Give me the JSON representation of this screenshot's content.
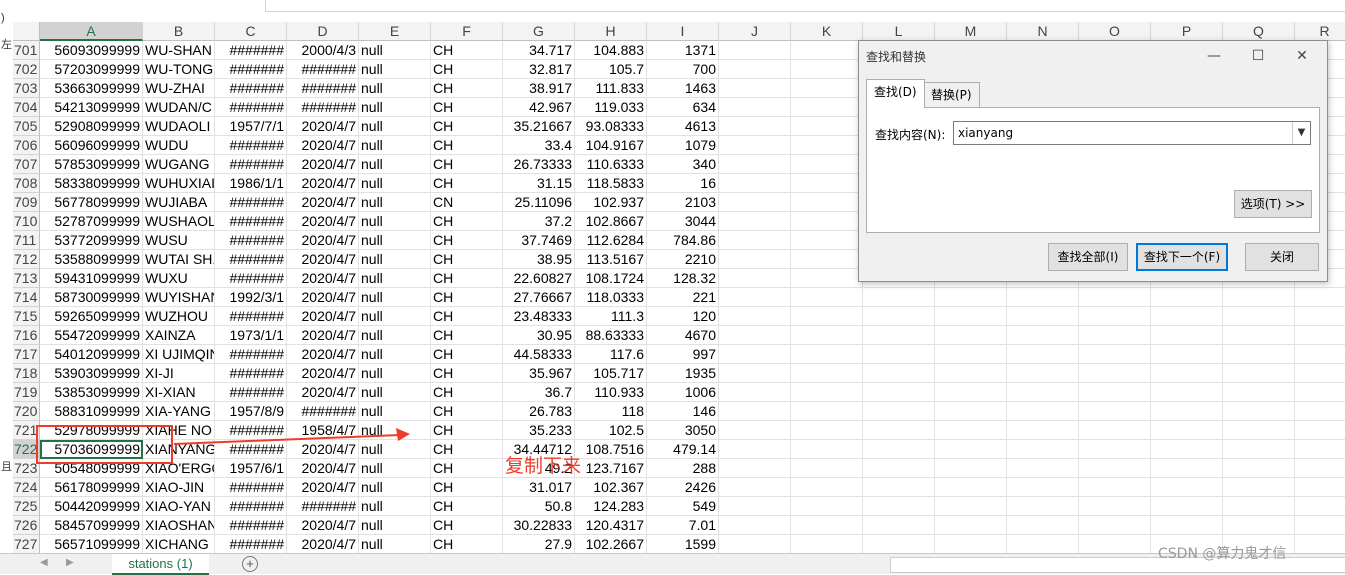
{
  "columns": [
    "A",
    "B",
    "C",
    "D",
    "E",
    "F",
    "G",
    "H",
    "I",
    "J",
    "K",
    "L",
    "M",
    "N",
    "O",
    "P",
    "Q",
    "R"
  ],
  "rows": [
    {
      "n": "701",
      "a": "56093099999",
      "b": "WU-SHAN",
      "c": "#######",
      "d": "2000/4/3",
      "e": "null",
      "f": "CH",
      "g": "34.717",
      "h": "104.883",
      "i": "1371"
    },
    {
      "n": "702",
      "a": "57203099999",
      "b": "WU-TONG",
      "c": "#######",
      "d": "#######",
      "e": "null",
      "f": "CH",
      "g": "32.817",
      "h": "105.7",
      "i": "700"
    },
    {
      "n": "703",
      "a": "53663099999",
      "b": "WU-ZHAI",
      "c": "#######",
      "d": "#######",
      "e": "null",
      "f": "CH",
      "g": "38.917",
      "h": "111.833",
      "i": "1463"
    },
    {
      "n": "704",
      "a": "54213099999",
      "b": "WUDAN/C",
      "c": "#######",
      "d": "#######",
      "e": "null",
      "f": "CH",
      "g": "42.967",
      "h": "119.033",
      "i": "634"
    },
    {
      "n": "705",
      "a": "52908099999",
      "b": "WUDAOLI",
      "c": "1957/7/1",
      "d": "2020/4/7",
      "e": "null",
      "f": "CH",
      "g": "35.21667",
      "h": "93.08333",
      "i": "4613"
    },
    {
      "n": "706",
      "a": "56096099999",
      "b": "WUDU",
      "c": "#######",
      "d": "2020/4/7",
      "e": "null",
      "f": "CH",
      "g": "33.4",
      "h": "104.9167",
      "i": "1079"
    },
    {
      "n": "707",
      "a": "57853099999",
      "b": "WUGANG",
      "c": "#######",
      "d": "2020/4/7",
      "e": "null",
      "f": "CH",
      "g": "26.73333",
      "h": "110.6333",
      "i": "340"
    },
    {
      "n": "708",
      "a": "58338099999",
      "b": "WUHUXIAI",
      "c": "1986/1/1",
      "d": "2020/4/7",
      "e": "null",
      "f": "CH",
      "g": "31.15",
      "h": "118.5833",
      "i": "16"
    },
    {
      "n": "709",
      "a": "56778099999",
      "b": "WUJIABA",
      "c": "#######",
      "d": "2020/4/7",
      "e": "null",
      "f": "CN",
      "g": "25.11096",
      "h": "102.937",
      "i": "2103"
    },
    {
      "n": "710",
      "a": "52787099999",
      "b": "WUSHAOL",
      "c": "#######",
      "d": "2020/4/7",
      "e": "null",
      "f": "CH",
      "g": "37.2",
      "h": "102.8667",
      "i": "3044"
    },
    {
      "n": "711",
      "a": "53772099999",
      "b": "WUSU",
      "c": "#######",
      "d": "2020/4/7",
      "e": "null",
      "f": "CH",
      "g": "37.7469",
      "h": "112.6284",
      "i": "784.86"
    },
    {
      "n": "712",
      "a": "53588099999",
      "b": "WUTAI SH.",
      "c": "#######",
      "d": "2020/4/7",
      "e": "null",
      "f": "CH",
      "g": "38.95",
      "h": "113.5167",
      "i": "2210"
    },
    {
      "n": "713",
      "a": "59431099999",
      "b": "WUXU",
      "c": "#######",
      "d": "2020/4/7",
      "e": "null",
      "f": "CH",
      "g": "22.60827",
      "h": "108.1724",
      "i": "128.32"
    },
    {
      "n": "714",
      "a": "58730099999",
      "b": "WUYISHAN",
      "c": "1992/3/1",
      "d": "2020/4/7",
      "e": "null",
      "f": "CH",
      "g": "27.76667",
      "h": "118.0333",
      "i": "221"
    },
    {
      "n": "715",
      "a": "59265099999",
      "b": "WUZHOU",
      "c": "#######",
      "d": "2020/4/7",
      "e": "null",
      "f": "CH",
      "g": "23.48333",
      "h": "111.3",
      "i": "120"
    },
    {
      "n": "716",
      "a": "55472099999",
      "b": "XAINZA",
      "c": "1973/1/1",
      "d": "2020/4/7",
      "e": "null",
      "f": "CH",
      "g": "30.95",
      "h": "88.63333",
      "i": "4670"
    },
    {
      "n": "717",
      "a": "54012099999",
      "b": "XI UJIMQIN",
      "c": "#######",
      "d": "2020/4/7",
      "e": "null",
      "f": "CH",
      "g": "44.58333",
      "h": "117.6",
      "i": "997"
    },
    {
      "n": "718",
      "a": "53903099999",
      "b": "XI-JI",
      "c": "#######",
      "d": "2020/4/7",
      "e": "null",
      "f": "CH",
      "g": "35.967",
      "h": "105.717",
      "i": "1935"
    },
    {
      "n": "719",
      "a": "53853099999",
      "b": "XI-XIAN",
      "c": "#######",
      "d": "2020/4/7",
      "e": "null",
      "f": "CH",
      "g": "36.7",
      "h": "110.933",
      "i": "1006"
    },
    {
      "n": "720",
      "a": "58831099999",
      "b": "XIA-YANG",
      "c": "1957/8/9",
      "d": "#######",
      "e": "null",
      "f": "CH",
      "g": "26.783",
      "h": "118",
      "i": "146"
    },
    {
      "n": "721",
      "a": "52978099999",
      "b": "XIAHE NO",
      "c": "#######",
      "d": "1958/4/7",
      "e": "null",
      "f": "CH",
      "g": "35.233",
      "h": "102.5",
      "i": "3050"
    },
    {
      "n": "722",
      "a": "57036099999",
      "b": "XIANYANG",
      "c": "#######",
      "d": "2020/4/7",
      "e": "null",
      "f": "CH",
      "g": "34.44712",
      "h": "108.7516",
      "i": "479.14"
    },
    {
      "n": "723",
      "a": "50548099999",
      "b": "XIAO'ERGO",
      "c": "1957/6/1",
      "d": "2020/4/7",
      "e": "null",
      "f": "CH",
      "g": "49.2",
      "h": "123.7167",
      "i": "288"
    },
    {
      "n": "724",
      "a": "56178099999",
      "b": "XIAO-JIN",
      "c": "#######",
      "d": "2020/4/7",
      "e": "null",
      "f": "CH",
      "g": "31.017",
      "h": "102.367",
      "i": "2426"
    },
    {
      "n": "725",
      "a": "50442099999",
      "b": "XIAO-YAN",
      "c": "#######",
      "d": "#######",
      "e": "null",
      "f": "CH",
      "g": "50.8",
      "h": "124.283",
      "i": "549"
    },
    {
      "n": "726",
      "a": "58457099999",
      "b": "XIAOSHAN",
      "c": "#######",
      "d": "2020/4/7",
      "e": "null",
      "f": "CH",
      "g": "30.22833",
      "h": "120.4317",
      "i": "7.01"
    },
    {
      "n": "727",
      "a": "56571099999",
      "b": "XICHANG",
      "c": "#######",
      "d": "2020/4/7",
      "e": "null",
      "f": "CH",
      "g": "27.9",
      "h": "102.2667",
      "i": "1599"
    }
  ],
  "selected_row": "722",
  "selected_column": "A",
  "annotation": "复制下来",
  "sheet_tab": "stations (1)",
  "watermark": "CSDN @算力鬼才信",
  "left_strip": [
    ")",
    "左",
    "且"
  ],
  "dialog": {
    "title": "查找和替换",
    "minimize": "—",
    "maximize": "☐",
    "close": "✕",
    "tab_find": "查找(D)",
    "tab_replace": "替换(P)",
    "find_label": "查找内容(N):",
    "find_value": "xianyang",
    "options_button": "选项(T) >>",
    "find_all_button": "查找全部(I)",
    "find_next_button": "查找下一个(F)",
    "close_button": "关闭"
  },
  "colors": {
    "accent": "#217346",
    "annotation": "#ef3b2c",
    "focus": "#0078d7"
  }
}
